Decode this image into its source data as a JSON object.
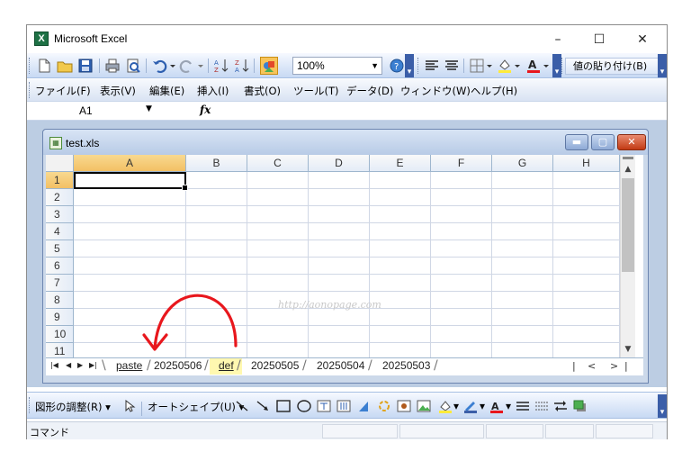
{
  "window": {
    "title": "Microsoft Excel",
    "minimize": "–",
    "maximize": "☐",
    "close": "✕",
    "app_icon": "X"
  },
  "toolbar": {
    "zoom": "100%",
    "paste_values": "値の貼り付け(B)"
  },
  "menu": [
    "ファイル(F)",
    "表示(V)",
    "編集(E)",
    "挿入(I)",
    "書式(O)",
    "ツール(T)",
    "データ(D)",
    "ウィンドウ(W)",
    "ヘルプ(H)"
  ],
  "formula_bar": {
    "name_box": "A1",
    "fx": "fx",
    "value": ""
  },
  "workbook": {
    "title": "test.xls",
    "columns": [
      "A",
      "B",
      "C",
      "D",
      "E",
      "F",
      "G",
      "H"
    ],
    "rows": [
      "1",
      "2",
      "3",
      "4",
      "5",
      "6",
      "7",
      "8",
      "9",
      "10",
      "11"
    ],
    "active_cell": "A1",
    "watermark": "http://aonopage.com"
  },
  "sheets": [
    {
      "label": "paste",
      "state": "normal"
    },
    {
      "label": "20250506",
      "state": "normal"
    },
    {
      "label": "def",
      "state": "selected"
    },
    {
      "label": "20250505",
      "state": "normal"
    },
    {
      "label": "20250504",
      "state": "normal"
    },
    {
      "label": "20250503",
      "state": "normal"
    }
  ],
  "drawing_toolbar": {
    "adjust": "図形の調整(R)",
    "autoshape": "オートシェイプ(U)"
  },
  "status": {
    "text": "コマンド"
  },
  "colors": {
    "accent": "#3b5ea8",
    "active_header": "#f3c064",
    "selected_tab": "#fff8b0",
    "annotation": "#e8171d"
  }
}
